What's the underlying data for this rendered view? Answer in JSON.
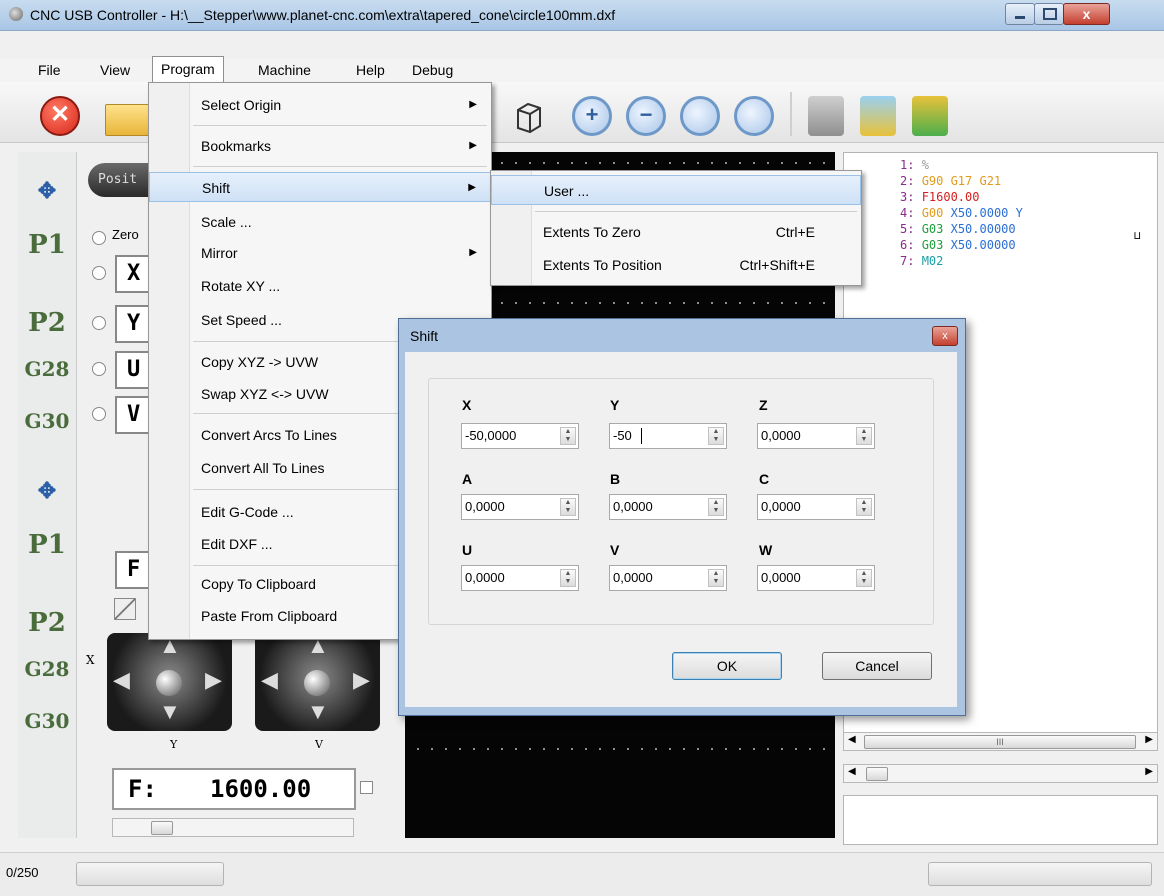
{
  "window": {
    "title": "CNC USB Controller - H:\\__Stepper\\www.planet-cnc.com\\extra\\tapered_cone\\circle100mm.dxf",
    "close_glyph": "x"
  },
  "menubar": {
    "items": [
      "File",
      "View",
      "Program",
      "Machine",
      "Help",
      "Debug"
    ]
  },
  "left_panel": {
    "position_tab": "Posit",
    "zero_label": "Zero",
    "axes": [
      "X",
      "Y",
      "U",
      "V"
    ],
    "strip": [
      "P1",
      "P2",
      "G28",
      "G30",
      "P1",
      "P2",
      "G28",
      "G30"
    ],
    "feed_label": "F",
    "feed_display": "F:",
    "feed_value": "1600.00",
    "joy_x": "X",
    "joy_y": "Y",
    "joy_v": "V"
  },
  "program_menu": {
    "items": [
      {
        "label": "Select Origin",
        "submenu": true
      },
      {
        "label": "Bookmarks",
        "submenu": true
      },
      {
        "label": "Shift",
        "submenu": true
      },
      {
        "label": "Scale ..."
      },
      {
        "label": "Mirror",
        "submenu": true
      },
      {
        "label": "Rotate XY ..."
      },
      {
        "label": "Set Speed ..."
      },
      {
        "label": "Copy XYZ -> UVW"
      },
      {
        "label": "Swap XYZ <-> UVW"
      },
      {
        "label": "Convert Arcs To Lines"
      },
      {
        "label": "Convert All To Lines"
      },
      {
        "label": "Edit G-Code ..."
      },
      {
        "label": "Edit DXF ..."
      },
      {
        "label": "Copy To Clipboard"
      },
      {
        "label": "Paste From Clipboard"
      }
    ]
  },
  "shift_submenu": {
    "items": [
      {
        "label": "User ...",
        "shortcut": ""
      },
      {
        "label": "Extents To Zero",
        "shortcut": "Ctrl+E"
      },
      {
        "label": "Extents To Position",
        "shortcut": "Ctrl+Shift+E"
      }
    ]
  },
  "code": {
    "lines": [
      {
        "n": "1:",
        "parts": [
          [
            "%",
            "c-gray"
          ]
        ]
      },
      {
        "n": "2:",
        "parts": [
          [
            "G90 G17 G21",
            "c-orange"
          ]
        ]
      },
      {
        "n": "3:",
        "parts": [
          [
            "F1600.00",
            "c-red"
          ]
        ]
      },
      {
        "n": "4:",
        "parts": [
          [
            "G00",
            "c-orange"
          ],
          [
            " X50.0000 Y",
            "c-blue"
          ]
        ]
      },
      {
        "n": "5:",
        "parts": [
          [
            "G03",
            "c-green"
          ],
          [
            " X50.00000",
            "c-blue"
          ]
        ]
      },
      {
        "n": "6:",
        "parts": [
          [
            "G03",
            "c-green"
          ],
          [
            " X50.00000",
            "c-blue"
          ]
        ]
      },
      {
        "n": "7:",
        "parts": [
          [
            "M02",
            "c-teal"
          ]
        ]
      }
    ],
    "scroll_mark": "III"
  },
  "dialog": {
    "title": "Shift",
    "fields": [
      {
        "label": "X",
        "value": "-50,0000"
      },
      {
        "label": "Y",
        "value": "-50"
      },
      {
        "label": "Z",
        "value": "0,0000"
      },
      {
        "label": "A",
        "value": "0,0000"
      },
      {
        "label": "B",
        "value": "0,0000"
      },
      {
        "label": "C",
        "value": "0,0000"
      },
      {
        "label": "U",
        "value": "0,0000"
      },
      {
        "label": "V",
        "value": "0,0000"
      },
      {
        "label": "W",
        "value": "0,0000"
      }
    ],
    "ok": "OK",
    "cancel": "Cancel"
  },
  "status": {
    "counter": "0/250"
  }
}
